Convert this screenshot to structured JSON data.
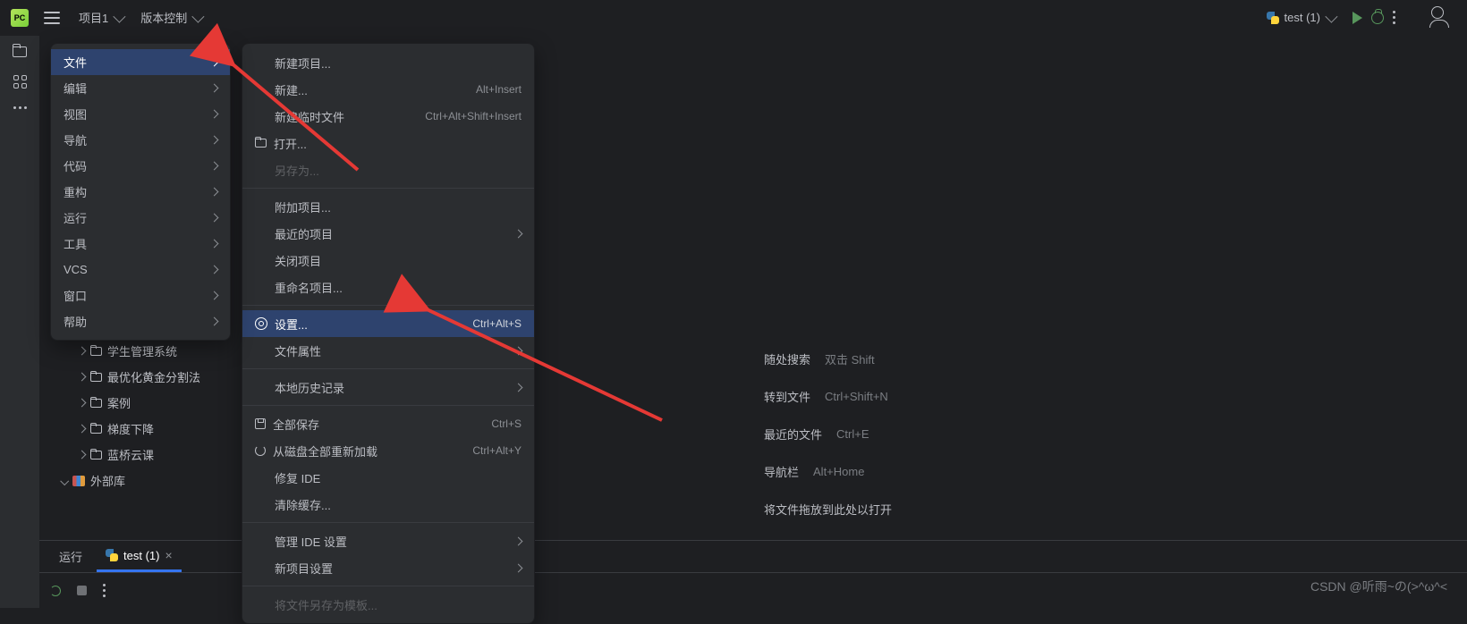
{
  "topbar": {
    "project_label": "项目1",
    "vcs_label": "版本控制",
    "run_config": "test (1)"
  },
  "menu1": {
    "items": [
      {
        "label": "文件",
        "sub": true,
        "selected": true
      },
      {
        "label": "编辑",
        "sub": true
      },
      {
        "label": "视图",
        "sub": true
      },
      {
        "label": "导航",
        "sub": true
      },
      {
        "label": "代码",
        "sub": true
      },
      {
        "label": "重构",
        "sub": true
      },
      {
        "label": "运行",
        "sub": true
      },
      {
        "label": "工具",
        "sub": true
      },
      {
        "label": "VCS",
        "sub": true
      },
      {
        "label": "窗口",
        "sub": true
      },
      {
        "label": "帮助",
        "sub": true
      }
    ]
  },
  "menu2": {
    "new_project": "新建项目...",
    "new": "新建...",
    "new_sc": "Alt+Insert",
    "new_scratch": "新建临时文件",
    "new_scratch_sc": "Ctrl+Alt+Shift+Insert",
    "open": "打开...",
    "save_as": "另存为...",
    "attach": "附加项目...",
    "recent": "最近的项目",
    "close_proj": "关闭项目",
    "rename": "重命名项目...",
    "settings": "设置...",
    "settings_sc": "Ctrl+Alt+S",
    "file_props": "文件属性",
    "local_history": "本地历史记录",
    "save_all": "全部保存",
    "save_all_sc": "Ctrl+S",
    "reload": "从磁盘全部重新加载",
    "reload_sc": "Ctrl+Alt+Y",
    "repair": "修复 IDE",
    "clear_cache": "清除缓存...",
    "manage_ide": "管理 IDE 设置",
    "new_proj_settings": "新项目设置",
    "save_as_tmpl": "将文件另存为模板..."
  },
  "tree": {
    "items": [
      {
        "label": "学生管理系统"
      },
      {
        "label": "最优化黄金分割法"
      },
      {
        "label": "案例"
      },
      {
        "label": "梯度下降"
      },
      {
        "label": "蓝桥云课"
      }
    ],
    "ext_libs": "外部库"
  },
  "bottom": {
    "run_tab": "运行",
    "test_tab": "test (1)"
  },
  "hints": {
    "search": "随处搜索",
    "search_kb": "双击 Shift",
    "gotofile": "转到文件",
    "gotofile_kb": "Ctrl+Shift+N",
    "recent": "最近的文件",
    "recent_kb": "Ctrl+E",
    "navbar": "导航栏",
    "navbar_kb": "Alt+Home",
    "drop": "将文件拖放到此处以打开"
  },
  "watermark": "CSDN @听雨~の(>^ω^<"
}
